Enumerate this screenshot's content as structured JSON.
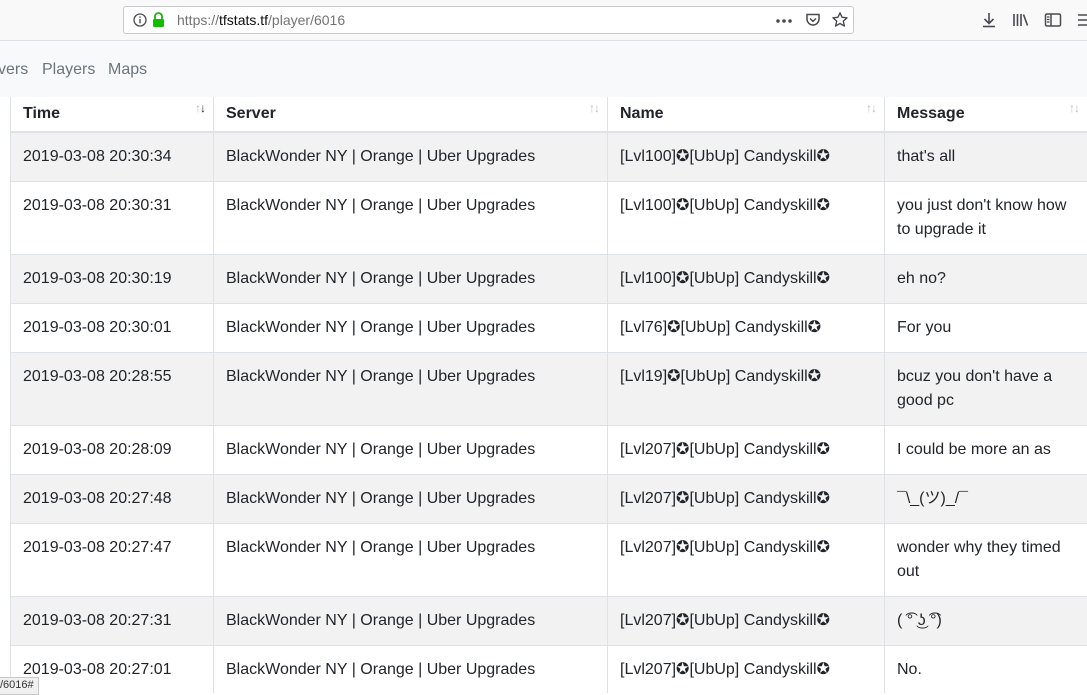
{
  "browser": {
    "url_prefix": "https://",
    "url_host": "tfstats.tf",
    "url_path": "/player/6016",
    "status_link": "/6016#"
  },
  "nav": {
    "items": [
      {
        "label": "vers"
      },
      {
        "label": "Players"
      },
      {
        "label": "Maps"
      }
    ]
  },
  "table": {
    "headers": {
      "time": "Time",
      "server": "Server",
      "name": "Name",
      "message": "Message"
    },
    "rows": [
      {
        "time": "2019-03-08 20:30:34",
        "server": "BlackWonder NY | Orange | Uber Upgrades",
        "name": "[Lvl100]✪[UbUp] Candyskill✪",
        "message": "that's all"
      },
      {
        "time": "2019-03-08 20:30:31",
        "server": "BlackWonder NY | Orange | Uber Upgrades",
        "name": "[Lvl100]✪[UbUp] Candyskill✪",
        "message": "you just don't know how to upgrade it"
      },
      {
        "time": "2019-03-08 20:30:19",
        "server": "BlackWonder NY | Orange | Uber Upgrades",
        "name": "[Lvl100]✪[UbUp] Candyskill✪",
        "message": "eh no?"
      },
      {
        "time": "2019-03-08 20:30:01",
        "server": "BlackWonder NY | Orange | Uber Upgrades",
        "name": "[Lvl76]✪[UbUp] Candyskill✪",
        "message": "For you"
      },
      {
        "time": "2019-03-08 20:28:55",
        "server": "BlackWonder NY | Orange | Uber Upgrades",
        "name": "[Lvl19]✪[UbUp] Candyskill✪",
        "message": "bcuz you don't have a good pc"
      },
      {
        "time": "2019-03-08 20:28:09",
        "server": "BlackWonder NY | Orange | Uber Upgrades",
        "name": "[Lvl207]✪[UbUp] Candyskill✪",
        "message": "I could be more an as"
      },
      {
        "time": "2019-03-08 20:27:48",
        "server": "BlackWonder NY | Orange | Uber Upgrades",
        "name": "[Lvl207]✪[UbUp] Candyskill✪",
        "message": "¯\\_(ツ)_/¯"
      },
      {
        "time": "2019-03-08 20:27:47",
        "server": "BlackWonder NY | Orange | Uber Upgrades",
        "name": "[Lvl207]✪[UbUp] Candyskill✪",
        "message": "wonder why they timed out"
      },
      {
        "time": "2019-03-08 20:27:31",
        "server": "BlackWonder NY | Orange | Uber Upgrades",
        "name": "[Lvl207]✪[UbUp] Candyskill✪",
        "message": "( ͡° ͜ʖ ͡°)"
      },
      {
        "time": "2019-03-08 20:27:01",
        "server": "BlackWonder NY | Orange | Uber Upgrades",
        "name": "[Lvl207]✪[UbUp] Candyskill✪",
        "message": "No."
      }
    ]
  }
}
